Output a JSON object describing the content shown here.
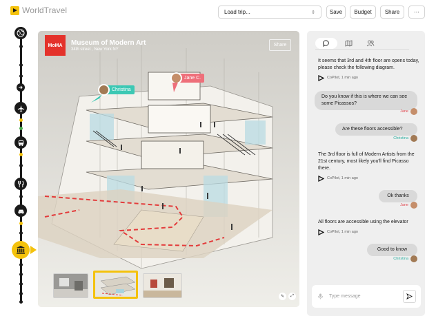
{
  "app": {
    "name": "WorldTravel"
  },
  "header": {
    "trip_select": {
      "value": "Load trip...",
      "placeholder": "Load trip..."
    },
    "buttons": {
      "save": "Save",
      "budget": "Budget",
      "share": "Share",
      "more": "⋯"
    }
  },
  "timeline": {
    "nodes": [
      "globe-icon",
      "arrow-right-icon",
      "plane-icon",
      "bus-icon",
      "restaurant-icon",
      "car-icon",
      "museum-icon"
    ],
    "active": "museum-icon"
  },
  "venue": {
    "logo_text": "MoMA",
    "name": "Museum of Modern Art",
    "address": "34th street , New York NY",
    "share_label": "Share"
  },
  "pins": [
    {
      "name": "Christina",
      "color": "#3cc8b4"
    },
    {
      "name": "Jane C.",
      "color": "#ee6f7a"
    }
  ],
  "thumbnails": [
    {
      "label": "gallery-interior"
    },
    {
      "label": "floor-diagram",
      "selected": true
    },
    {
      "label": "gallery-room"
    }
  ],
  "chat": {
    "tabs": [
      "chat-icon",
      "map-icon",
      "people-icon"
    ],
    "active_tab": "chat-icon",
    "messages": [
      {
        "from": "ai",
        "text": "It seems that 3rd and 4th floor are opens today, please check the following diagram.",
        "meta": "CoPilot, 1 min ago"
      },
      {
        "from": "user",
        "text": "Do you know if this is where we can see some Picassos?",
        "meta": "Jane",
        "color": "#e0454d"
      },
      {
        "from": "user",
        "text": "Are these floors accessible?",
        "meta": "Christina",
        "color": "#2aaea0"
      },
      {
        "from": "ai",
        "text": "The 3rd floor is full of Modern Artists from the 21st century, most likely you'll find Picasso there.",
        "meta": "CoPilot, 1 min ago"
      },
      {
        "from": "user",
        "text": "Ok thanks",
        "meta": "Jane",
        "color": "#e0454d"
      },
      {
        "from": "ai",
        "text": "All floors are accessible using the elevator",
        "meta": "CoPilot, 1 min ago"
      },
      {
        "from": "user",
        "text": "Good to know",
        "meta": "Christina",
        "color": "#2aaea0"
      }
    ],
    "input_placeholder": "Type message"
  },
  "colors": {
    "accent": "#f4c20d",
    "jane": "#ee6f7a",
    "christina": "#3cc8b4",
    "route": "#e33b3b"
  }
}
